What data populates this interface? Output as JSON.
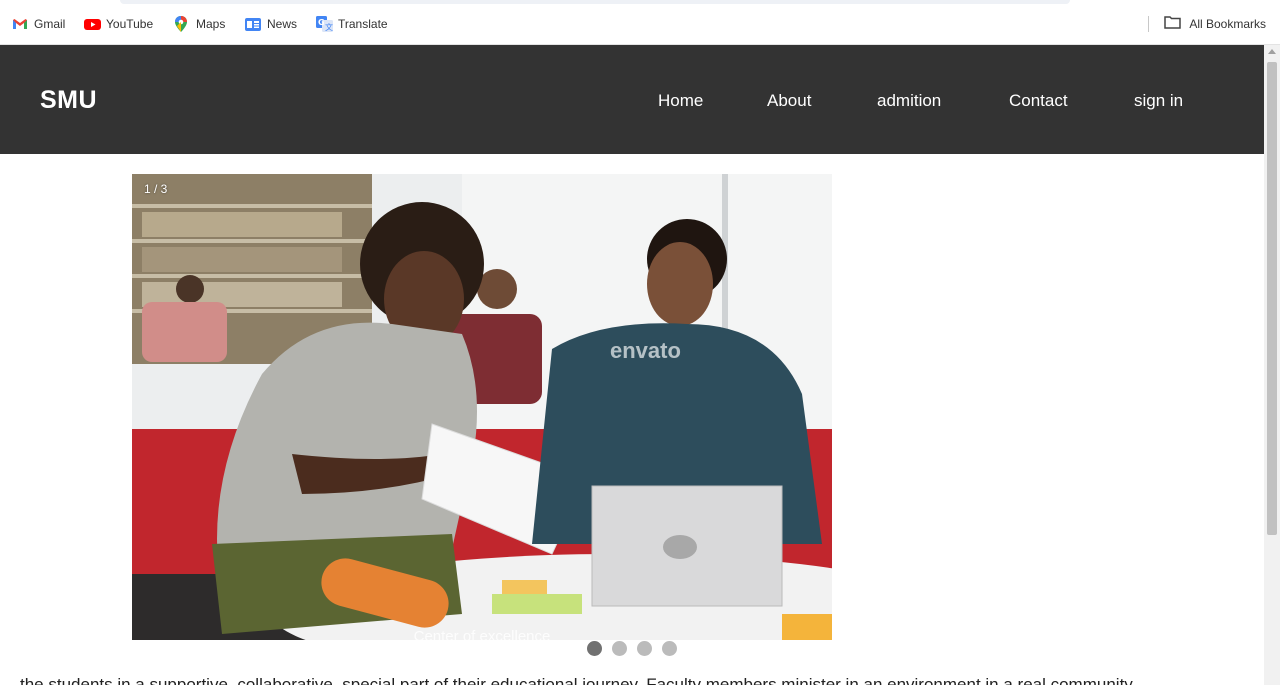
{
  "bookmarks": {
    "items": [
      {
        "label": "Gmail",
        "icon": "gmail-icon"
      },
      {
        "label": "YouTube",
        "icon": "youtube-icon"
      },
      {
        "label": "Maps",
        "icon": "maps-icon"
      },
      {
        "label": "News",
        "icon": "news-icon"
      },
      {
        "label": "Translate",
        "icon": "translate-icon"
      }
    ],
    "all_bookmarks": "All Bookmarks"
  },
  "header": {
    "logo": "SMU",
    "nav": [
      "Home",
      "About",
      "admition",
      "Contact",
      "sign in"
    ]
  },
  "slideshow": {
    "counter": "1 / 3",
    "caption": "Center of excellence",
    "watermark": "envato",
    "dot_count": 4,
    "active_dot": 0
  },
  "body_text": "the students in a supportive, collaborative, special part of their educational journey. Faculty members minister in an environment in a real community"
}
